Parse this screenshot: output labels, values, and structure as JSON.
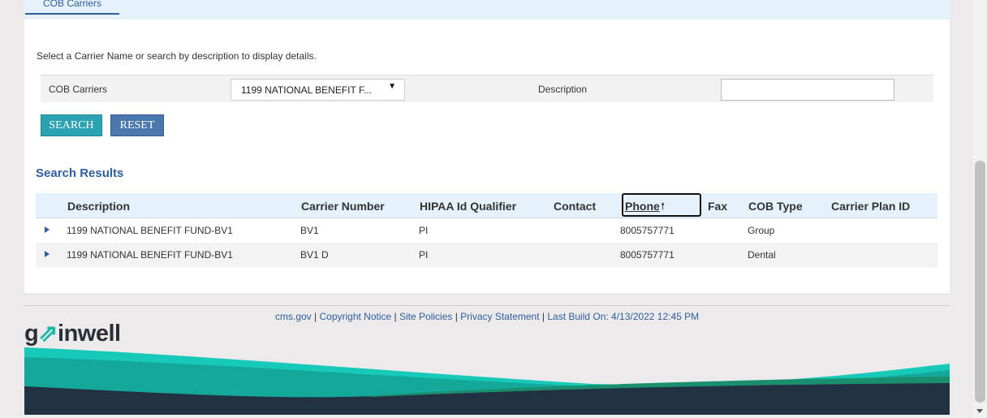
{
  "tabs": {
    "active_label": "COB Carriers"
  },
  "instructions": "Select a Carrier Name or search by description to display details.",
  "filters": {
    "carrier_label": "COB Carriers",
    "carrier_selected": "1199 NATIONAL BENEFIT F...",
    "description_label": "Description",
    "description_value": ""
  },
  "buttons": {
    "search_label": "SEARCH",
    "reset_label": "RESET"
  },
  "results": {
    "title": "Search Results",
    "columns": [
      "Description",
      "Carrier Number",
      "HIPAA Id Qualifier",
      "Contact",
      "Phone",
      "Fax",
      "COB Type",
      "Carrier Plan ID"
    ],
    "sort_column": "Phone",
    "sort_direction": "ascending",
    "rows": [
      {
        "description": "1199 NATIONAL BENEFIT FUND-BV1",
        "carrier_number": "BV1",
        "hipaa": "PI",
        "contact": "",
        "phone": "8005757771",
        "fax": "",
        "cob_type": "Group",
        "plan_id": ""
      },
      {
        "description": "1199 NATIONAL BENEFIT FUND-BV1",
        "carrier_number": "BV1 D",
        "hipaa": "PI",
        "contact": "",
        "phone": "8005757771",
        "fax": "",
        "cob_type": "Dental",
        "plan_id": ""
      }
    ]
  },
  "footer": {
    "links": [
      "cms.gov",
      "Copyright Notice",
      "Site Policies",
      "Privacy Statement"
    ],
    "separator": " | ",
    "build_text": "Last Build On: 4/13/2022 12:45 PM",
    "logo_text_1": "g",
    "logo_mark": "⇗",
    "logo_text_2": "inwell"
  },
  "colors": {
    "accent": "#2e5e9e",
    "teal": "#17b7a6",
    "search_button": "#2aa2b2",
    "reset_button": "#4a77ad",
    "footer_dark": "#233242"
  },
  "icons": {
    "expand": "triangle-right-icon",
    "sort": "arrow-up-icon",
    "dropdown": "chevron-down-icon"
  }
}
